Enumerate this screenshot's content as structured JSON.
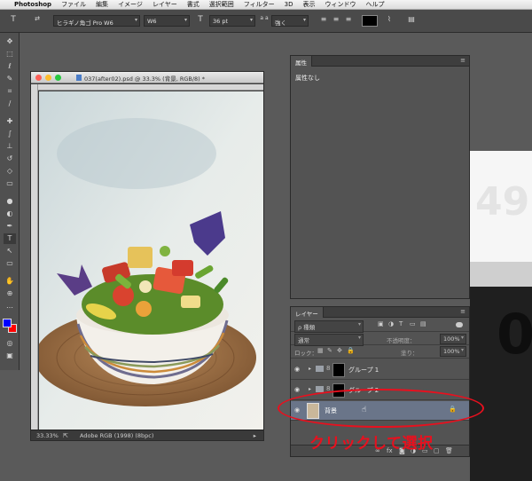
{
  "menubar": {
    "app": "Photoshop",
    "items": [
      "ファイル",
      "編集",
      "イメージ",
      "レイヤー",
      "書式",
      "選択範囲",
      "フィルター",
      "3D",
      "表示",
      "ウィンドウ",
      "ヘルプ"
    ]
  },
  "options": {
    "tool_icon": "T",
    "font_family": "ヒラギノ角ゴ Pro W6",
    "font_style": "W6",
    "size_icon": "T",
    "font_size": "36 pt",
    "aa_label": "a a",
    "antialias": "強く",
    "text_color": "#000000"
  },
  "document": {
    "title": "037(after02).psd @ 33.3% (背景, RGB/8) *",
    "zoom": "33.33%",
    "color_profile": "Adobe RGB (1998) (8bpc)"
  },
  "properties": {
    "tab": "属性",
    "content": "属性なし"
  },
  "layers": {
    "tab": "レイヤー",
    "filter_kind": "ρ 種類",
    "blend_mode": "通常",
    "opacity_label": "不透明度：",
    "opacity_value": "100%",
    "lock_label": "ロック：",
    "fill_label": "塗り：",
    "fill_value": "100%",
    "rows": [
      {
        "name": "グループ 1"
      },
      {
        "name": "グループ 2"
      },
      {
        "name": "背景"
      }
    ]
  },
  "annotation": {
    "text": "クリックして選択",
    "color": "#e8101e"
  },
  "background": {
    "number_top": "49",
    "number_bottom": "0"
  }
}
